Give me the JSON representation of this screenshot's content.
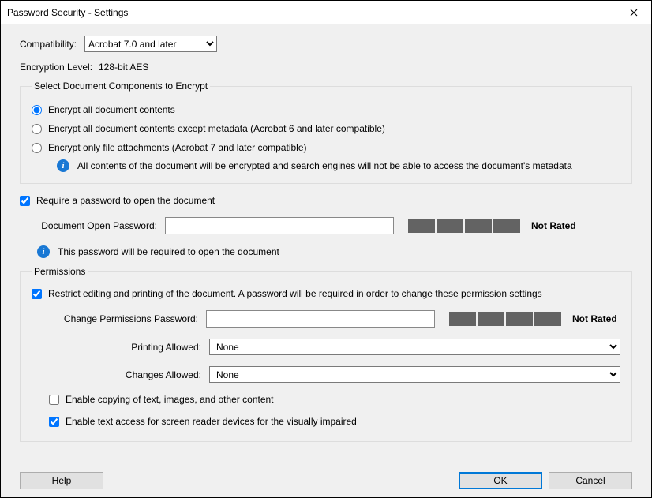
{
  "window": {
    "title": "Password Security - Settings"
  },
  "compat": {
    "label": "Compatibility:",
    "value": "Acrobat 7.0 and later"
  },
  "encryption": {
    "label": "Encryption  Level:",
    "value": "128-bit AES"
  },
  "encrypt_group": {
    "legend": "Select Document Components to Encrypt",
    "opt1": "Encrypt all document contents",
    "opt2": "Encrypt all document contents except metadata (Acrobat 6 and later compatible)",
    "opt3": "Encrypt only file attachments (Acrobat 7 and later compatible)",
    "info": "All contents of the document will be encrypted and search engines will not be able to access the document's metadata"
  },
  "open_pw": {
    "require_label": "Require a password to open the document",
    "field_label": "Document Open Password:",
    "rating": "Not Rated",
    "info": "This password will be required to open the document"
  },
  "permissions": {
    "legend": "Permissions",
    "restrict_label": "Restrict editing and printing of the document. A password will be required in order to change these permission settings",
    "pw_label": "Change Permissions Password:",
    "rating": "Not Rated",
    "printing_label": "Printing Allowed:",
    "printing_value": "None",
    "changes_label": "Changes Allowed:",
    "changes_value": "None",
    "copy_label": "Enable copying of text, images, and other content",
    "screen_reader_label": "Enable text access for screen reader devices for the visually impaired"
  },
  "buttons": {
    "help": "Help",
    "ok": "OK",
    "cancel": "Cancel"
  }
}
